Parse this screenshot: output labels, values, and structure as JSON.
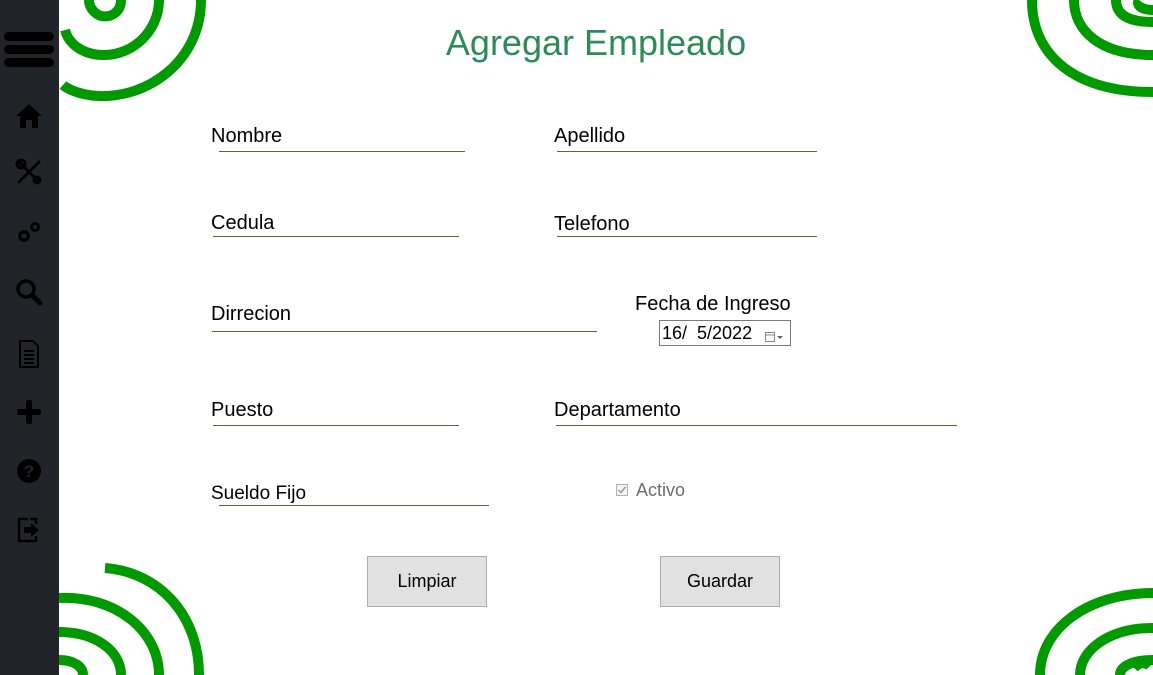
{
  "title": "Agregar Empleado",
  "sidebar": {
    "icons": [
      "menu-icon",
      "home-icon",
      "tools-icon",
      "gears-icon",
      "search-icon",
      "document-icon",
      "plus-icon",
      "help-icon",
      "logout-icon"
    ]
  },
  "form": {
    "nombre_label": "Nombre",
    "apellido_label": "Apellido",
    "cedula_label": "Cedula",
    "telefono_label": "Telefono",
    "direccion_label": "Dirrecion",
    "fecha_label": "Fecha de Ingreso",
    "fecha_value": "16/  5/2022",
    "puesto_label": "Puesto",
    "departamento_label": "Departamento",
    "sueldo_label": "Sueldo Fijo",
    "activo_label": "Activo",
    "activo_checked": true
  },
  "buttons": {
    "limpiar": "Limpiar",
    "guardar": "Guardar"
  },
  "colors": {
    "sidebar": "#212529",
    "title": "#2e8b57",
    "spiral": "#009900",
    "underline": "#556b2f"
  }
}
